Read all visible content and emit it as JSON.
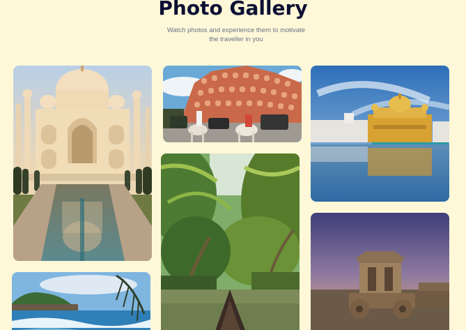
{
  "gallery": {
    "title": "Photo Gallery",
    "subtitle": "Watch photos and experience them to motivate the traveller in you"
  },
  "photos": [
    {
      "id": "taj-mahal",
      "caption": ""
    },
    {
      "id": "hawa-mahal",
      "caption": ""
    },
    {
      "id": "golden-temple",
      "caption": ""
    },
    {
      "id": "kerala-backwaters",
      "caption": ""
    },
    {
      "id": "hampi-chariot",
      "caption": ""
    },
    {
      "id": "beach-coast",
      "caption": ""
    }
  ],
  "colors": {
    "background": "#fef8d8",
    "title": "#0d1033",
    "subtitle": "#6b6f86"
  }
}
